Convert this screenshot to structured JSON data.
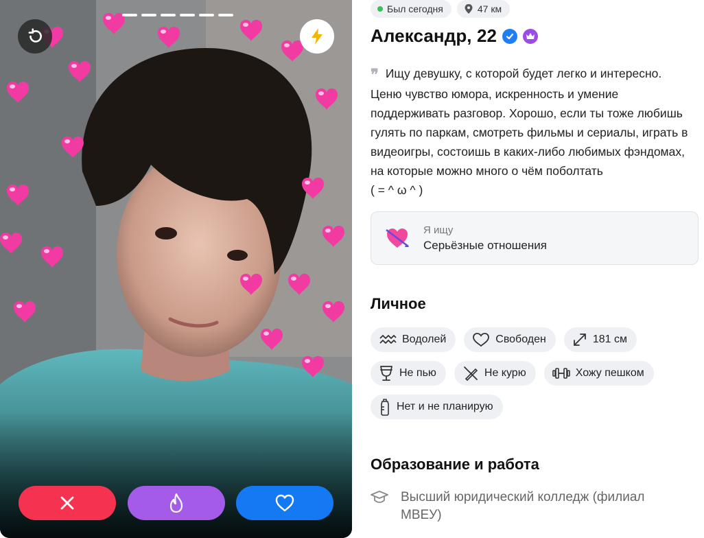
{
  "status": {
    "last_seen": "Был сегодня",
    "distance": "47 км"
  },
  "profile": {
    "name_age": "Александр, 22"
  },
  "bio": {
    "lines": [
      "Ищу девушку, с которой будет легко и интересно.",
      "Ценю чувство юмора, искренность и умение",
      "поддерживать разговор. Хорошо, если ты тоже любишь",
      "гулять по паркам, смотреть фильмы и сериалы, играть в",
      "видеоигры, состоишь в каких-либо любимых фэндомах,",
      "на которые можно много о чём поболтать",
      "( = ^ ω ^ )"
    ]
  },
  "looking_for": {
    "title": "Я ищу",
    "value": "Серьёзные отношения",
    "icon": "heart-arrow-icon"
  },
  "personal": {
    "title": "Личное",
    "tags": [
      {
        "label": "Водолей",
        "icon": "aquarius-icon"
      },
      {
        "label": "Свободен",
        "icon": "heart-outline-icon"
      },
      {
        "label": "181 см",
        "icon": "expand-arrows-icon"
      },
      {
        "label": "Не пью",
        "icon": "glass-icon"
      },
      {
        "label": "Не курю",
        "icon": "no-smoking-icon"
      },
      {
        "label": "Хожу пешком",
        "icon": "dumbbell-icon"
      },
      {
        "label": "Нет и не планирую",
        "icon": "baby-bottle-icon"
      }
    ]
  },
  "education": {
    "title": "Образование и работа",
    "item": "Высший юридический колледж (филиал МВЕУ)",
    "icon": "graduation-cap-icon"
  },
  "photo": {
    "total": 6,
    "current": 1
  },
  "buttons": {
    "undo": "undo-icon",
    "boost": "lightning-icon",
    "dislike": "close-icon",
    "superlike": "flame-icon",
    "like": "heart-icon"
  },
  "colors": {
    "dislike": "#f5324f",
    "superlike": "#a45be8",
    "like": "#1479f2",
    "verified": "#1f7ef3",
    "premium": "#9d4ce5",
    "boost": "#f4b400"
  }
}
